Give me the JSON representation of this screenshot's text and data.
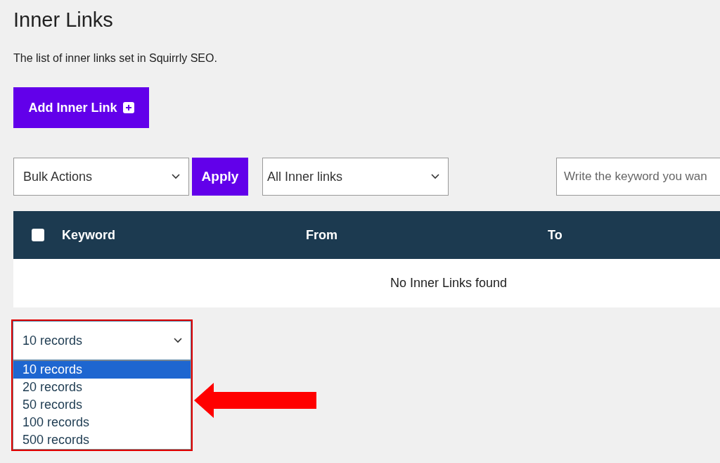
{
  "title": "Inner Links",
  "description": "The list of inner links set in Squirrly SEO.",
  "add_button": {
    "label": "Add Inner Link"
  },
  "bulk_actions": {
    "value": "Bulk Actions"
  },
  "apply_button": {
    "label": "Apply"
  },
  "filter": {
    "value": "All Inner links"
  },
  "search": {
    "placeholder": "Write the keyword you wan"
  },
  "table": {
    "select_all_checked": false,
    "columns": [
      "Keyword",
      "From",
      "To"
    ],
    "empty_message": "No Inner Links found"
  },
  "records": {
    "value": "10 records",
    "expanded": true,
    "options": [
      {
        "label": "10 records",
        "selected": true
      },
      {
        "label": "20 records",
        "selected": false
      },
      {
        "label": "50 records",
        "selected": false
      },
      {
        "label": "100 records",
        "selected": false
      },
      {
        "label": "500 records",
        "selected": false
      }
    ]
  }
}
